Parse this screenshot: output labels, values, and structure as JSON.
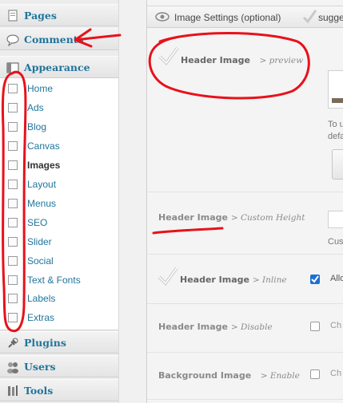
{
  "sidebar": {
    "menus": [
      {
        "id": "pages",
        "label": "Pages",
        "icon": "pages-icon"
      },
      {
        "id": "comments",
        "label": "Comments",
        "icon": "comment-bubble-icon"
      },
      {
        "id": "appearance",
        "label": "Appearance",
        "icon": "appearance-icon"
      },
      {
        "id": "plugins",
        "label": "Plugins",
        "icon": "plug-icon"
      },
      {
        "id": "users",
        "label": "Users",
        "icon": "users-icon"
      },
      {
        "id": "tools",
        "label": "Tools",
        "icon": "tools-icon"
      }
    ],
    "submenu": [
      {
        "label": "Home"
      },
      {
        "label": "Ads"
      },
      {
        "label": "Blog"
      },
      {
        "label": "Canvas"
      },
      {
        "label": "Images",
        "current": true
      },
      {
        "label": "Layout"
      },
      {
        "label": "Menus"
      },
      {
        "label": "SEO"
      },
      {
        "label": "Slider"
      },
      {
        "label": "Social"
      },
      {
        "label": "Text & Fonts"
      },
      {
        "label": "Labels"
      },
      {
        "label": "Extras"
      }
    ]
  },
  "panel": {
    "title": "Image Settings (optional)",
    "suggest": "sugge",
    "header_icon": "eye-icon"
  },
  "options": {
    "preview": {
      "label": "Header Image",
      "sub": "> preview"
    },
    "preview_help": {
      "line1": "To u",
      "line2": "defa"
    },
    "custom_height": {
      "label": "Header Image",
      "sub": "> Custom Height",
      "help": "Cus"
    },
    "inline": {
      "label": "Header Image",
      "sub": "> Inline",
      "text": "Allo",
      "checked": true
    },
    "disable": {
      "label": "Header Image",
      "sub": "> Disable",
      "text": "Ch",
      "checked": false
    },
    "background": {
      "label": "Background Image",
      "sub": "> Enable",
      "text": "Ch",
      "checked": false
    }
  },
  "colors": {
    "link": "#21759b",
    "annotation": "#e8111a",
    "checkbox_checked": "#1e6fd0"
  }
}
